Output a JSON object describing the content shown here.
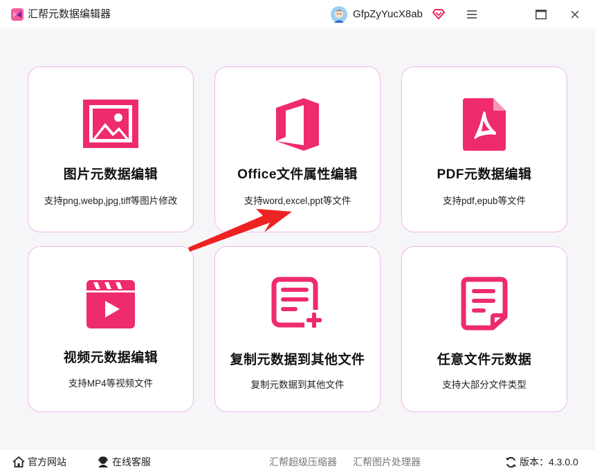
{
  "app": {
    "title": "汇帮元数据编辑器",
    "username": "GfpZyYucX8ab",
    "accent": "#ee2b6c",
    "card_border": "#f1b7e8"
  },
  "cards": [
    {
      "title": "图片元数据编辑",
      "desc": "支持png,webp,jpg,tiff等图片修改",
      "icon": "image-icon"
    },
    {
      "title": "Office文件属性编辑",
      "desc": "支持word,excel,ppt等文件",
      "icon": "office-icon"
    },
    {
      "title": "PDF元数据编辑",
      "desc": "支持pdf,epub等文件",
      "icon": "pdf-icon"
    },
    {
      "title": "视频元数据编辑",
      "desc": "支持MP4等视频文件",
      "icon": "video-icon"
    },
    {
      "title": "复制元数据到其他文件",
      "desc": "复制元数据到其他文件",
      "icon": "copy-document-icon"
    },
    {
      "title": "任意文件元数据",
      "desc": "支持大部分文件类型",
      "icon": "file-note-icon"
    }
  ],
  "footer": {
    "official_site": "官方网站",
    "support": "在线客服",
    "link1": "汇帮超级压缩器",
    "link2": "汇帮图片处理器",
    "version_label": "版本：",
    "version": "4.3.0.0"
  }
}
